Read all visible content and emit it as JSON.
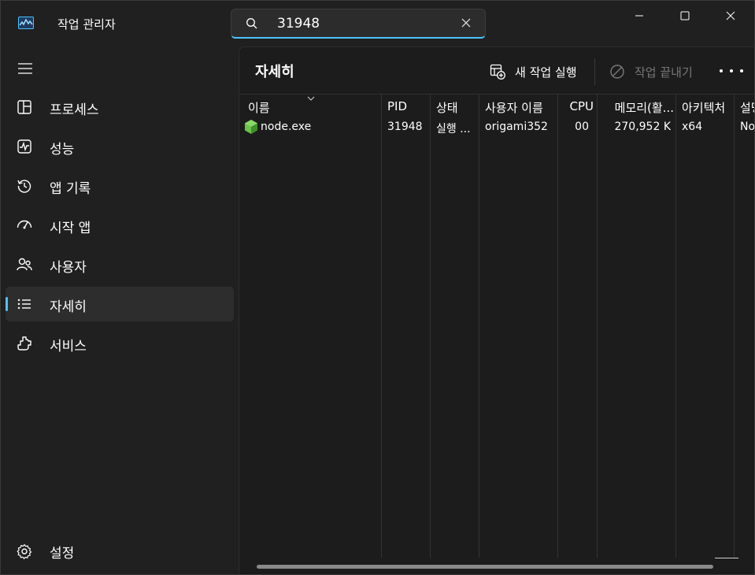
{
  "app": {
    "title": "작업 관리자"
  },
  "search": {
    "value": "31948"
  },
  "nav": {
    "items": [
      {
        "label": "프로세스",
        "icon": "processes-icon"
      },
      {
        "label": "성능",
        "icon": "performance-icon"
      },
      {
        "label": "앱 기록",
        "icon": "app-history-icon"
      },
      {
        "label": "시작 앱",
        "icon": "startup-apps-icon"
      },
      {
        "label": "사용자",
        "icon": "users-icon"
      },
      {
        "label": "자세히",
        "icon": "details-icon",
        "active": true
      },
      {
        "label": "서비스",
        "icon": "services-icon"
      }
    ],
    "settings_label": "설정"
  },
  "page": {
    "title": "자세히",
    "run_task_label": "새 작업 실행",
    "end_task_label": "작업 끝내기"
  },
  "table": {
    "headers": {
      "name": "이름",
      "pid": "PID",
      "status": "상태",
      "user": "사용자 이름",
      "cpu": "CPU",
      "memory": "메모리(활...",
      "arch": "아키텍처",
      "desc": "설명"
    },
    "rows": [
      {
        "name": "node.exe",
        "pid": "31948",
        "status": "실행 ...",
        "user": "origami352",
        "cpu": "00",
        "memory": "270,952 K",
        "arch": "x64",
        "desc": "No"
      }
    ]
  },
  "colors": {
    "accent": "#4cc2ff",
    "window_bg": "#202020",
    "panel_bg": "#1c1c1c",
    "node_green": "#6cc24a"
  }
}
